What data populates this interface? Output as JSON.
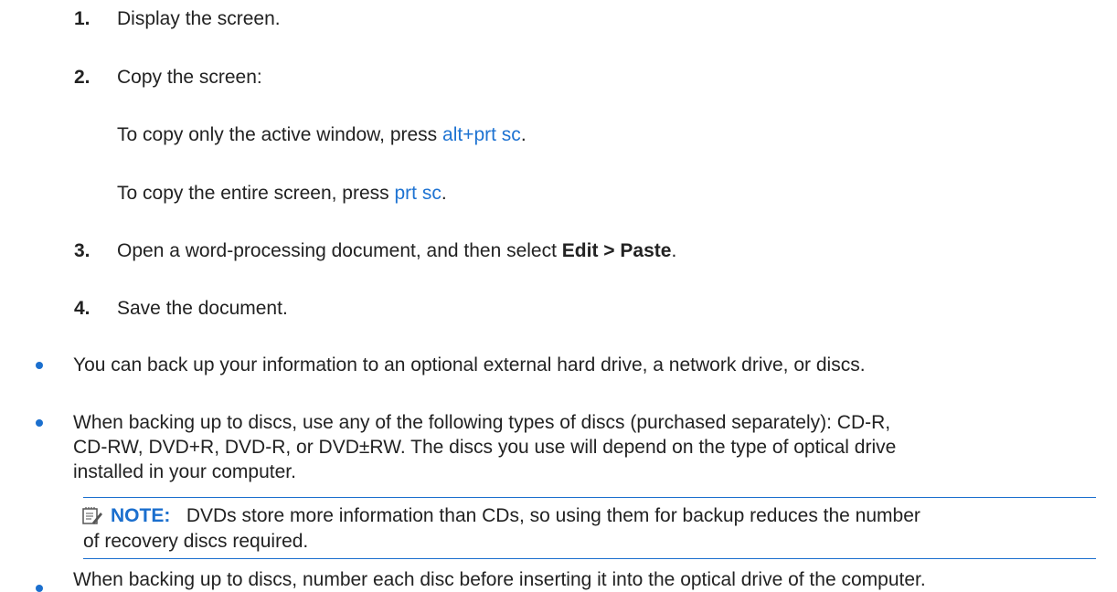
{
  "steps": [
    {
      "num": "1.",
      "text": "Display the screen."
    },
    {
      "num": "2.",
      "text": "Copy the screen:"
    },
    {
      "num": "3.",
      "text_before": "Open a word-processing document, and then select ",
      "bold": "Edit > Paste",
      "text_after": "."
    },
    {
      "num": "4.",
      "text": "Save the document."
    }
  ],
  "sub": {
    "active_before": "To copy only the active window, press ",
    "active_key": "alt+prt sc",
    "active_after": ".",
    "entire_before": "To copy the entire screen, press ",
    "entire_key": "prt sc",
    "entire_after": "."
  },
  "bullets": [
    {
      "lines": [
        "You can back up your information to an optional external hard drive, a network drive, or discs."
      ]
    },
    {
      "lines": [
        "When backing up to discs, use any of the following types of discs (purchased separately): CD-R,",
        "CD-RW, DVD+R, DVD-R, or DVD±RW. The discs you use will depend on the type of optical drive",
        "installed in your computer."
      ]
    },
    {
      "lines": [
        "When backing up to discs, number each disc before inserting it into the optical drive of the computer."
      ]
    }
  ],
  "note": {
    "label": "NOTE:",
    "line1": "DVDs store more information than CDs, so using them for backup reduces the number",
    "line2": "of recovery discs required."
  },
  "colors": {
    "accent": "#1b6fce",
    "link": "#1e73d2",
    "text": "#222222"
  },
  "icons": {
    "note": "note-pad-icon",
    "bullet": "bullet-dot-icon"
  }
}
